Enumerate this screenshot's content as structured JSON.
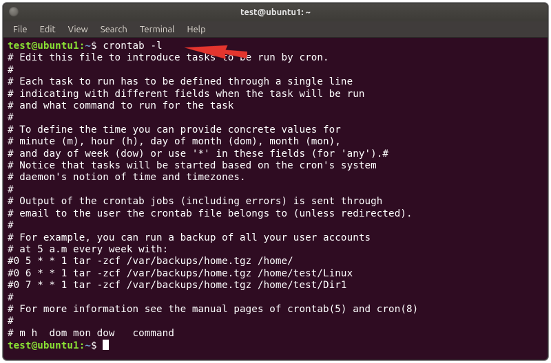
{
  "titlebar": {
    "title": "test@ubuntu1: ~"
  },
  "menubar": {
    "items": [
      "File",
      "Edit",
      "View",
      "Search",
      "Terminal",
      "Help"
    ]
  },
  "prompt": {
    "userhost": "test@ubuntu1:",
    "path": "~",
    "symbol": "$",
    "command": "crontab -l"
  },
  "output": [
    "# Edit this file to introduce tasks to be run by cron.",
    "#",
    "# Each task to run has to be defined through a single line",
    "# indicating with different fields when the task will be run",
    "# and what command to run for the task",
    "#",
    "# To define the time you can provide concrete values for",
    "# minute (m), hour (h), day of month (dom), month (mon),",
    "# and day of week (dow) or use '*' in these fields (for 'any').#",
    "# Notice that tasks will be started based on the cron's system",
    "# daemon's notion of time and timezones.",
    "#",
    "# Output of the crontab jobs (including errors) is sent through",
    "# email to the user the crontab file belongs to (unless redirected).",
    "#",
    "# For example, you can run a backup of all your user accounts",
    "# at 5 a.m every week with:",
    "#0 5 * * 1 tar -zcf /var/backups/home.tgz /home/",
    "#0 6 * * 1 tar -zcf /var/backups/home.tgz /home/test/Linux",
    "#0 7 * * 1 tar -zcf /var/backups/home.tgz /home/test/Dir1",
    "#",
    "# For more information see the manual pages of crontab(5) and cron(8)",
    "#",
    "# m h  dom mon dow   command"
  ],
  "annotation": {
    "arrow_color": "#e3342f"
  }
}
